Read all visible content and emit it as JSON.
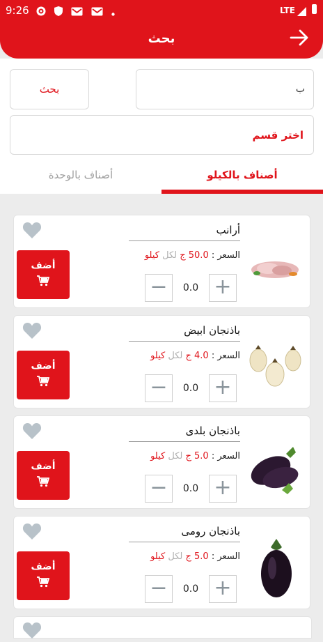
{
  "status_bar": {
    "time": "9:26",
    "network": "LTE"
  },
  "header": {
    "title": "بحث"
  },
  "search": {
    "query": "ب",
    "button_label": "بحث",
    "category_label": "اختر قسم"
  },
  "tabs": [
    {
      "label": "أصناف بالكيلو"
    },
    {
      "label": "أصناف بالوحدة"
    }
  ],
  "products": [
    {
      "name": "أرانب",
      "price_label": "السعر :",
      "price": "50.0 ج",
      "per": "لكل",
      "unit": "كيلو",
      "qty": "0.0",
      "add_label": "أضف",
      "image": "rabbit-meat"
    },
    {
      "name": "باذنجان ابيض",
      "price_label": "السعر :",
      "price": "4.0 ج",
      "per": "لكل",
      "unit": "كيلو",
      "qty": "0.0",
      "add_label": "أضف",
      "image": "white-eggplant"
    },
    {
      "name": "باذنجان بلدى",
      "price_label": "السعر :",
      "price": "5.0 ج",
      "per": "لكل",
      "unit": "كيلو",
      "qty": "0.0",
      "add_label": "أضف",
      "image": "local-eggplant"
    },
    {
      "name": "باذنجان رومى",
      "price_label": "السعر :",
      "price": "5.0 ج",
      "per": "لكل",
      "unit": "كيلو",
      "qty": "0.0",
      "add_label": "أضف",
      "image": "roman-eggplant"
    }
  ],
  "colors": {
    "accent": "#e0141b",
    "heart": "#b8c2c9",
    "background": "#ececec"
  }
}
